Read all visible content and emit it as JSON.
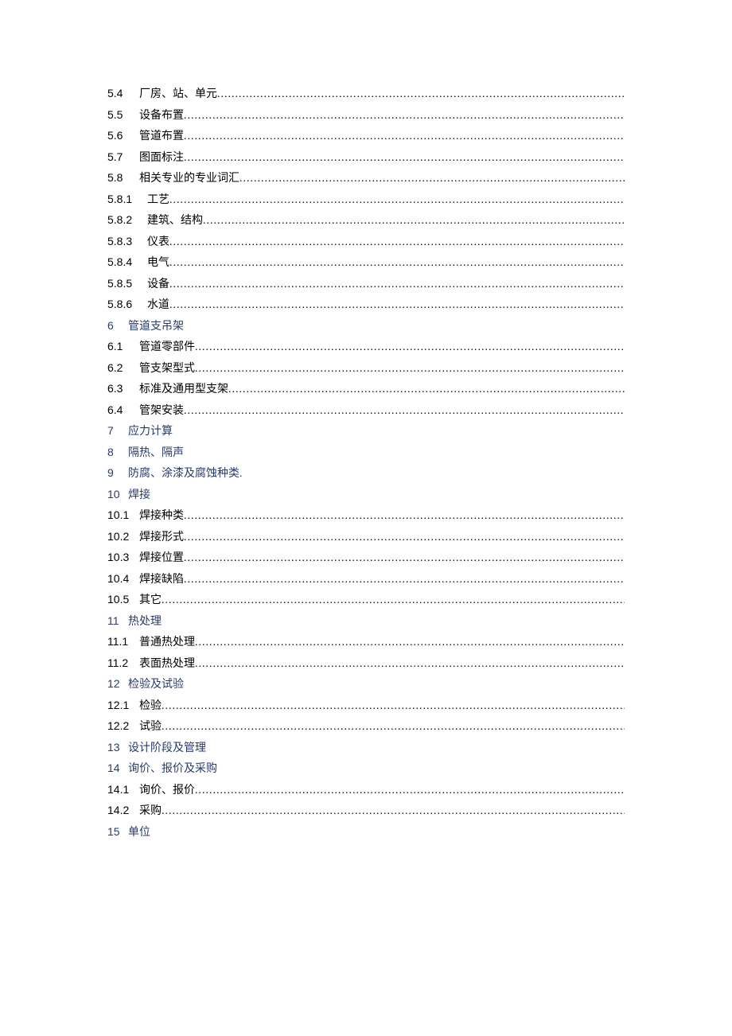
{
  "toc": [
    {
      "num": "5.4",
      "title": "厂房、站、单元",
      "level": 2,
      "header": false,
      "dots": true
    },
    {
      "num": "5.5",
      "title": "设备布置",
      "level": 2,
      "header": false,
      "dots": true
    },
    {
      "num": "5.6",
      "title": "管道布置",
      "level": 2,
      "header": false,
      "dots": true
    },
    {
      "num": "5.7",
      "title": "图面标注",
      "level": 2,
      "header": false,
      "dots": true
    },
    {
      "num": "5.8",
      "title": "相关专业的专业词汇",
      "level": 2,
      "header": false,
      "dots": true
    },
    {
      "num": "5.8.1",
      "title": "工艺",
      "level": 3,
      "header": false,
      "dots": true
    },
    {
      "num": "5.8.2",
      "title": "建筑、结构",
      "level": 3,
      "header": false,
      "dots": true
    },
    {
      "num": "5.8.3",
      "title": "仪表",
      "level": 3,
      "header": false,
      "dots": true
    },
    {
      "num": "5.8.4",
      "title": "电气",
      "level": 3,
      "header": false,
      "dots": true
    },
    {
      "num": "5.8.5",
      "title": "设备",
      "level": 3,
      "header": false,
      "dots": true
    },
    {
      "num": "5.8.6",
      "title": "水道",
      "level": 3,
      "header": false,
      "dots": true
    },
    {
      "num": "6",
      "title": "管道支吊架",
      "level": 1,
      "header": true,
      "dots": false
    },
    {
      "num": "6.1",
      "title": "管道零部件",
      "level": 2,
      "header": false,
      "dots": true
    },
    {
      "num": "6.2",
      "title": "管支架型式",
      "level": 2,
      "header": false,
      "dots": true
    },
    {
      "num": "6.3",
      "title": "标准及通用型支架",
      "level": 2,
      "header": false,
      "dots": true
    },
    {
      "num": "6.4",
      "title": "管架安装",
      "level": 2,
      "header": false,
      "dots": true
    },
    {
      "num": "7",
      "title": "应力计算",
      "level": 1,
      "header": true,
      "dots": false
    },
    {
      "num": "8",
      "title": "隔热、隔声",
      "level": 1,
      "header": true,
      "dots": false
    },
    {
      "num": "9",
      "title": "防腐、涂漆及腐蚀种类.",
      "level": 1,
      "header": true,
      "dots": false
    },
    {
      "num": "10",
      "title": "焊接",
      "level": 1,
      "header": true,
      "dots": false
    },
    {
      "num": "10.1",
      "title": "焊接种类",
      "level": 2,
      "header": false,
      "dots": true
    },
    {
      "num": "10.2",
      "title": "焊接形式",
      "level": 2,
      "header": false,
      "dots": true
    },
    {
      "num": "10.3",
      "title": "焊接位置",
      "level": 2,
      "header": false,
      "dots": true
    },
    {
      "num": "10.4",
      "title": "焊接缺陷",
      "level": 2,
      "header": false,
      "dots": true
    },
    {
      "num": "10.5",
      "title": "其它",
      "level": 2,
      "header": false,
      "dots": true
    },
    {
      "num": "11",
      "title": "热处理",
      "level": 1,
      "header": true,
      "dots": false
    },
    {
      "num": "11.1",
      "title": "普通热处理",
      "level": 2,
      "header": false,
      "dots": true
    },
    {
      "num": "11.2",
      "title": "表面热处理",
      "level": 2,
      "header": false,
      "dots": true
    },
    {
      "num": "12",
      "title": "检验及试验",
      "level": 1,
      "header": true,
      "dots": false
    },
    {
      "num": "12.1",
      "title": "检验",
      "level": 2,
      "header": false,
      "dots": true
    },
    {
      "num": "12.2",
      "title": "试验",
      "level": 2,
      "header": false,
      "dots": true
    },
    {
      "num": "13",
      "title": "设计阶段及管理",
      "level": 1,
      "header": true,
      "dots": false
    },
    {
      "num": "14",
      "title": "询价、报价及采购",
      "level": 1,
      "header": true,
      "dots": false
    },
    {
      "num": "14.1",
      "title": "询价、报价",
      "level": 2,
      "header": false,
      "dots": true
    },
    {
      "num": "14.2",
      "title": "采购",
      "level": 2,
      "header": false,
      "dots": true
    },
    {
      "num": "15",
      "title": "单位",
      "level": 1,
      "header": true,
      "dots": false
    }
  ]
}
